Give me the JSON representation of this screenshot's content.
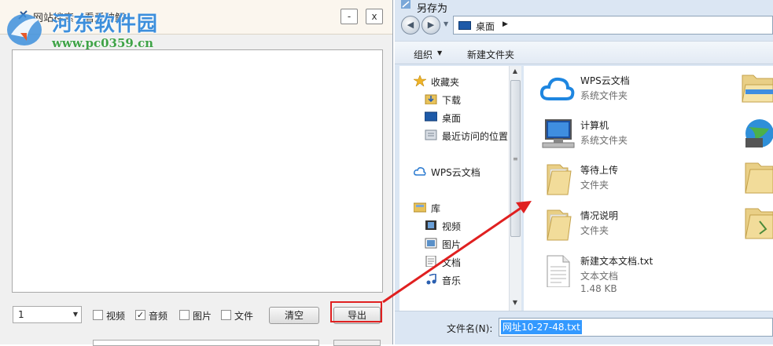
{
  "left_window": {
    "title": "网站搜索一看爱破解",
    "minimize_label": "-",
    "close_label": "x",
    "page_select": {
      "value": "1"
    },
    "filters": [
      {
        "label": "视频",
        "checked": false
      },
      {
        "label": "音频",
        "checked": true
      },
      {
        "label": "图片",
        "checked": false
      },
      {
        "label": "文件",
        "checked": false
      }
    ],
    "clear_label": "清空",
    "export_label": "导出"
  },
  "watermark": {
    "title": "河东软件园",
    "url": "www.pc0359.cn"
  },
  "save_dialog": {
    "title": "另存为",
    "address": "桌面",
    "toolbar": {
      "organize": "组织",
      "new_folder": "新建文件夹"
    },
    "nav": {
      "favorites": "收藏夹",
      "downloads": "下载",
      "desktop": "桌面",
      "recent": "最近访问的位置",
      "wps_cloud": "WPS云文档",
      "libraries": "库",
      "videos": "视频",
      "pictures": "图片",
      "documents": "文档",
      "music": "音乐"
    },
    "files": [
      {
        "name": "WPS云文档",
        "type": "系统文件夹",
        "icon": "cloud-icon"
      },
      {
        "name": "计算机",
        "type": "系统文件夹",
        "icon": "computer-icon"
      },
      {
        "name": "等待上传",
        "type": "文件夹",
        "icon": "folder-icon"
      },
      {
        "name": "情况说明",
        "type": "文件夹",
        "icon": "folder-icon"
      },
      {
        "name": "新建文本文档.txt",
        "type": "文本文档",
        "size": "1.48 KB",
        "icon": "text-file-icon"
      }
    ],
    "filename_label": "文件名(N):",
    "filename_value": "网址10-27-48.txt"
  },
  "colors": {
    "highlight": "#e02020",
    "selection": "#3399ff",
    "watermark_blue": "#3d8fdc",
    "watermark_green": "#3fa347"
  }
}
